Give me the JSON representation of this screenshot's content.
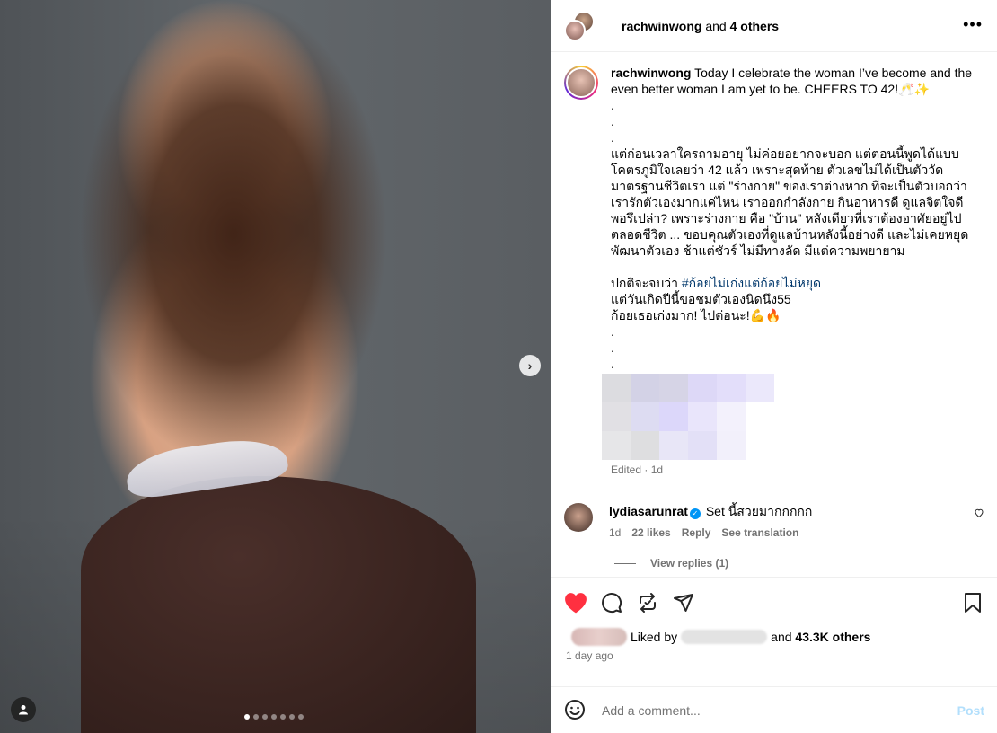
{
  "media": {
    "next_arrow": "›",
    "carousel_count": 7,
    "carousel_active": 0
  },
  "header": {
    "username": "rachwinwong",
    "joiner": " and ",
    "others": "4 others",
    "more": "•••"
  },
  "caption": {
    "username": "rachwinwong",
    "lines": [
      " Today I celebrate the woman I’ve become and the even better woman I am yet to be. CHEERS TO 42!🥂✨",
      ".",
      ".",
      ".",
      "แต่ก่อนเวลาใครถามอายุ ไม่ค่อยอยากจะบอก แต่ตอนนี้พูดได้แบบโคตรภูมิใจเลยว่า 42 แล้ว เพราะสุดท้าย ตัวเลขไม่ได้เป็นตัววัดมาตรฐานชีวิตเรา แต่ \"ร่างกาย\" ของเราต่างหาก ที่จะเป็นตัวบอกว่า เรารักตัวเองมากแค่ไหน เราออกกำลังกาย กินอาหารดี ดูแลจิตใจดีพอรึเปล่า? เพราะร่างกาย คือ \"บ้าน\" หลังเดียวที่เราต้องอาศัยอยู่ไปตลอดชีวิต ... ขอบคุณตัวเองที่ดูแลบ้านหลังนี้อย่างดี และไม่เคยหยุดพัฒนาตัวเอง ช้าแต่ชัวร์ ไม่มีทางลัด มีแต่ความพยายาม",
      " "
    ],
    "line_prefix": "ปกติจะจบว่า ",
    "hashtag": "#ก้อยไม่เก่งแต่ก้อยไม่หยุด",
    "lines2": [
      "แต่วันเกิดปีนี้ขอชมตัวเองนิดนึง55",
      "ก้อยเธอเก่งมาก! ไปต่อนะ!💪🔥",
      ".",
      ".",
      "."
    ],
    "edited": "Edited · 1d"
  },
  "comment": {
    "username": "lydiasarunrat",
    "verified": "✓",
    "text": " Set นี้สวยมากกกกก",
    "time": "1d",
    "likes": "22 likes",
    "reply": "Reply",
    "translate": "See translation",
    "view_replies": "View replies (1)"
  },
  "partial_comment": {
    "text": "·· ·· ·· ❤️"
  },
  "likes": {
    "liked_by": "Liked by",
    "and": "and",
    "others": "43.3K others",
    "time": "1 day ago"
  },
  "add_comment": {
    "placeholder": "Add a comment...",
    "post": "Post"
  },
  "colors": {
    "like_red": "#ff3040",
    "link_blue": "#0095f6",
    "post_disabled": "#b2dffc",
    "hashtag": "#00376b",
    "muted": "#737373"
  }
}
